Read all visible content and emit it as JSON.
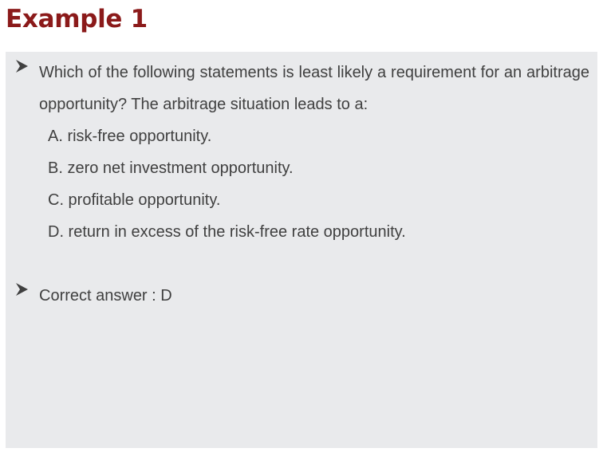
{
  "page": {
    "title": "Example 1"
  },
  "question": {
    "text": "Which of the following statements is least likely a requirement for an arbitrage opportunity? The arbitrage situation leads to a:",
    "options": [
      "A. risk-free opportunity.",
      "B. zero net investment opportunity.",
      "C. profitable opportunity.",
      "D. return in excess of the risk-free rate opportunity."
    ]
  },
  "answer": {
    "text": "Correct answer : D"
  },
  "colors": {
    "title": "#8b1a1a",
    "panel_background": "#e9eaec",
    "body_text": "#404040",
    "bullet": "#404040"
  },
  "icons": {
    "bullet": "arrowhead-bullet-icon"
  }
}
